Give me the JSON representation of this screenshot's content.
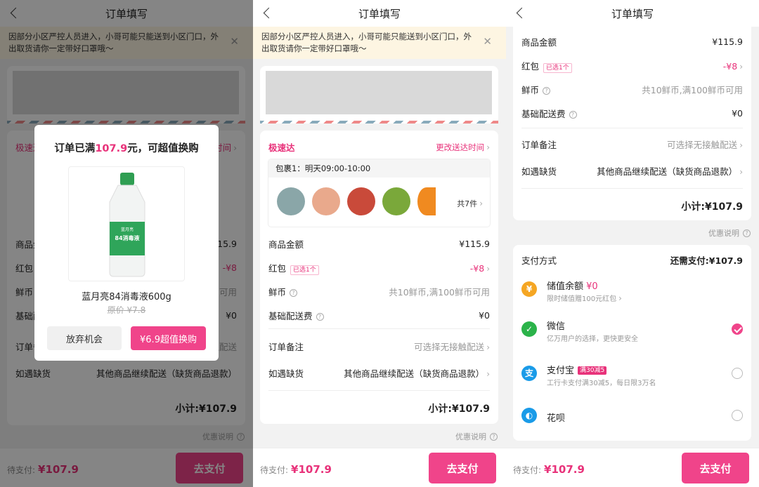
{
  "title": "订单填写",
  "notice": "因部分小区严控人员进入，小哥可能只能送到小区门口，外出取货请你一定带好口罩哦～",
  "delivery": {
    "type": "极速达",
    "change_time": "更改送达时间",
    "package": "包裹1：明天09:00-10:00",
    "count": "共7件"
  },
  "amounts": {
    "goods_label": "商品金额",
    "goods_value": "¥115.9",
    "redpacket_label": "红包",
    "redpacket_tag": "已选1个",
    "redpacket_value": "-¥8",
    "coin_label": "鲜币",
    "coin_value": "共10鲜币,满100鲜币可用",
    "fee_label": "基础配送费",
    "fee_value": "¥0",
    "remark_label": "订单备注",
    "remark_value": "可选择无接触配送",
    "shortage_label": "如遇缺货",
    "shortage_value": "其他商品继续配送（缺货商品退款）",
    "subtotal": "小计:¥107.9"
  },
  "discount_note": "优惠说明",
  "bottom": {
    "pending_label": "待支付:",
    "pending_amount": "¥107.9",
    "pay_button": "去支付"
  },
  "modal": {
    "title_prefix": "订单已满",
    "title_amount": "107.9",
    "title_suffix": "元，可超值换购",
    "product_name": "蓝月亮84消毒液600g",
    "original_price": "原价 ¥7.8",
    "bottle_label": "84消毒液",
    "bottle_brand": "蓝月亮",
    "giveup_button": "放弃机会",
    "buy_button": "¥6.9超值换购"
  },
  "payment": {
    "title": "支付方式",
    "need_pay": "还需支付:¥107.9",
    "methods": [
      {
        "name": "储值余额",
        "extra": "¥0",
        "sub": "限时储值赠100元红包",
        "icon": "¥",
        "color": "#f5a623",
        "selected": false
      },
      {
        "name": "微信",
        "sub": "亿万用户的选择，更快更安全",
        "icon": "✓",
        "color": "#2bb34a",
        "selected": true
      },
      {
        "name": "支付宝",
        "badge": "满30减5",
        "sub": "工行卡支付满30减5，每日限3万名",
        "icon": "支",
        "color": "#1a9be8",
        "selected": false
      },
      {
        "name": "花呗",
        "icon": "◐",
        "color": "#1a9be8",
        "selected": false
      }
    ]
  },
  "colors": {
    "accent": "#f0448a",
    "notice_bg": "#fdf5e2"
  }
}
